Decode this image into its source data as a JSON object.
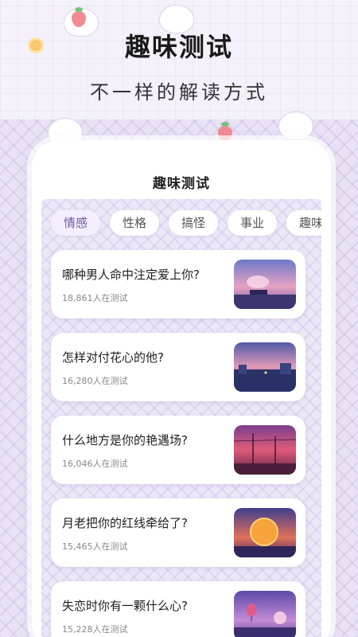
{
  "header": {
    "title": "趣味测试",
    "subtitle": "不一样的解读方式"
  },
  "screen": {
    "title": "趣味测试",
    "tabs": [
      {
        "label": "情感",
        "active": true
      },
      {
        "label": "性格",
        "active": false
      },
      {
        "label": "搞怪",
        "active": false
      },
      {
        "label": "事业",
        "active": false
      },
      {
        "label": "趣味",
        "active": false
      }
    ],
    "tests": [
      {
        "title": "哪种男人命中注定爱上你?",
        "count": "18,861人在测试",
        "image": "pink-sky-city"
      },
      {
        "title": "怎样对付花心的他?",
        "count": "16,280人在测试",
        "image": "dusk-street"
      },
      {
        "title": "什么地方是你的艳遇场?",
        "count": "16,046人在测试",
        "image": "crimson-crossing"
      },
      {
        "title": "月老把你的红线牵给了?",
        "count": "15,465人在测试",
        "image": "orange-moon"
      },
      {
        "title": "失恋时你有一颗什么心?",
        "count": "15,228人在测试",
        "image": "purple-balloon"
      }
    ]
  },
  "colors": {
    "accent": "#6f5aa8",
    "background": "#ece6f6"
  }
}
